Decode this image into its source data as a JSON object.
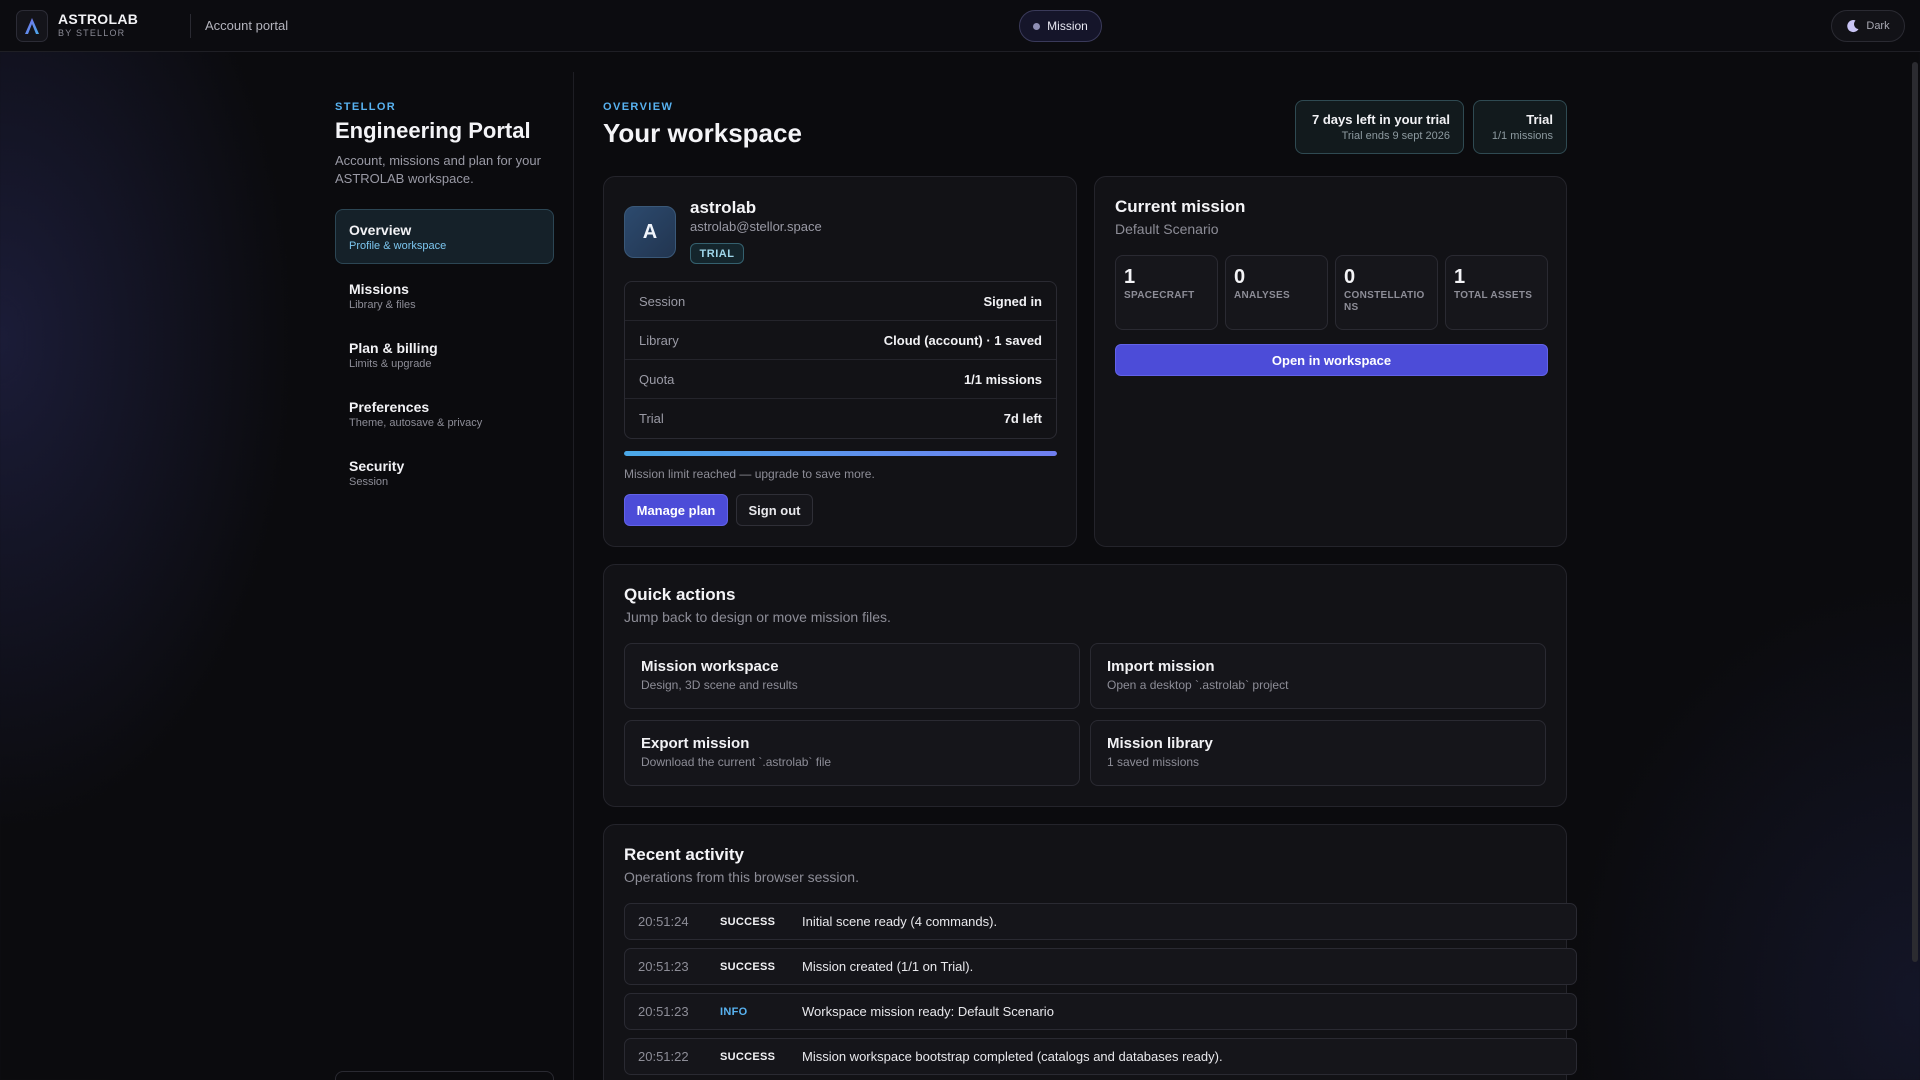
{
  "topbar": {
    "brand_name": "ASTROLAB",
    "brand_sub": "BY STELLOR",
    "portal_link": "Account portal",
    "mission_pill": "Mission",
    "theme_toggle": "Dark"
  },
  "sidebar": {
    "kicker": "STELLOR",
    "title": "Engineering Portal",
    "description": "Account, missions and plan for your ASTROLAB workspace.",
    "items": [
      {
        "label": "Overview",
        "sub": "Profile & workspace",
        "active": true
      },
      {
        "label": "Missions",
        "sub": "Library & files"
      },
      {
        "label": "Plan & billing",
        "sub": "Limits & upgrade"
      },
      {
        "label": "Preferences",
        "sub": "Theme, autosave & privacy"
      },
      {
        "label": "Security",
        "sub": "Session"
      }
    ]
  },
  "header": {
    "kicker": "OVERVIEW",
    "title": "Your workspace",
    "trial_chip": {
      "main": "7 days left in your trial",
      "sub": "Trial ends 9 sept 2026"
    },
    "plan_chip": {
      "main": "Trial",
      "sub": "1/1 missions"
    }
  },
  "profile": {
    "avatar_letter": "A",
    "name": "astrolab",
    "email": "astrolab@stellor.space",
    "badge": "TRIAL",
    "rows": [
      {
        "key": "Session",
        "value": "Signed in"
      },
      {
        "key": "Library",
        "value": "Cloud (account) · 1 saved"
      },
      {
        "key": "Quota",
        "value": "1/1 missions"
      },
      {
        "key": "Trial",
        "value": "7d left"
      }
    ],
    "progress_percent": 100,
    "limit_note": "Mission limit reached — upgrade to save more.",
    "manage_plan": "Manage plan",
    "sign_out": "Sign out"
  },
  "current_mission": {
    "title": "Current mission",
    "scenario": "Default Scenario",
    "metrics": [
      {
        "value": "1",
        "label": "SPACECRAFT"
      },
      {
        "value": "0",
        "label": "ANALYSES"
      },
      {
        "value": "0",
        "label": "CONSTELLATIONS"
      },
      {
        "value": "1",
        "label": "TOTAL ASSETS"
      }
    ],
    "open_button": "Open in workspace"
  },
  "quick_actions": {
    "title": "Quick actions",
    "subtitle": "Jump back to design or move mission files.",
    "tiles": [
      {
        "title": "Mission workspace",
        "sub": "Design, 3D scene and results"
      },
      {
        "title": "Import mission",
        "sub": "Open a desktop `.astrolab` project"
      },
      {
        "title": "Export mission",
        "sub": "Download the current `.astrolab` file"
      },
      {
        "title": "Mission library",
        "sub": "1 saved missions"
      }
    ]
  },
  "activity": {
    "title": "Recent activity",
    "subtitle": "Operations from this browser session.",
    "rows": [
      {
        "time": "20:51:24",
        "status": "SUCCESS",
        "message": "Initial scene ready (4 commands)."
      },
      {
        "time": "20:51:23",
        "status": "SUCCESS",
        "message": "Mission created (1/1 on Trial)."
      },
      {
        "time": "20:51:23",
        "status": "INFO",
        "message": "Workspace mission ready: Default Scenario"
      },
      {
        "time": "20:51:22",
        "status": "SUCCESS",
        "message": "Mission workspace bootstrap completed (catalogs and databases ready)."
      }
    ]
  },
  "colors": {
    "accent": "#4c4cd8",
    "kicker": "#58b2f0",
    "background": "#0b0b0e"
  }
}
